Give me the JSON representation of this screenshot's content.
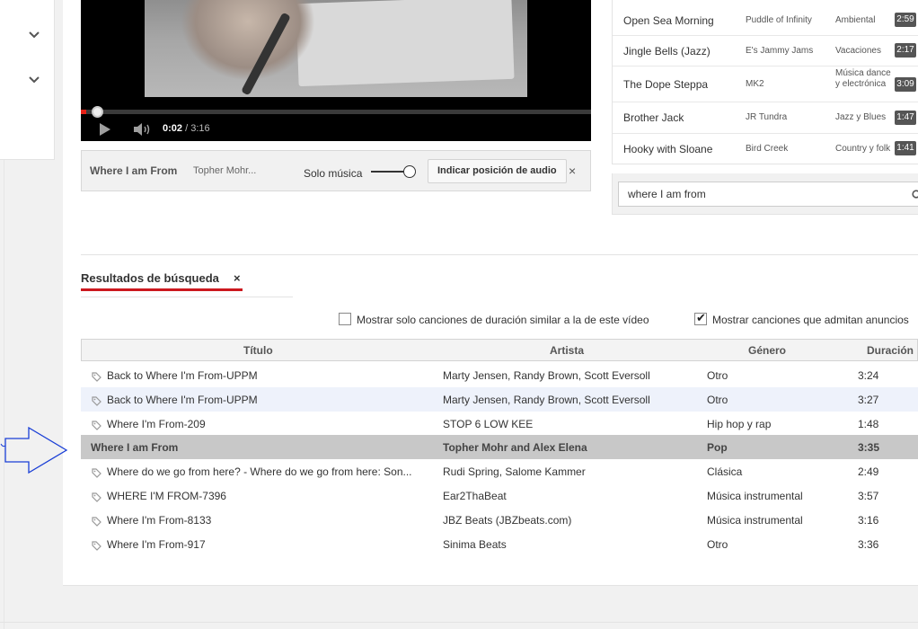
{
  "player": {
    "time_current": "0:02",
    "time_separator": " / ",
    "time_total": "3:16",
    "progress": 0.0106
  },
  "audio_bar": {
    "title": "Where I am From",
    "artist": "Topher Mohr...",
    "toggle_label": "Solo música",
    "toggle_on": true,
    "position_button": "Indicar posición de audio",
    "close": "×"
  },
  "song_list": [
    {
      "title": "Open Sea Morning",
      "artist": "Puddle of Infinity",
      "genre": "Ambiental",
      "duration": "2:59"
    },
    {
      "title": "Jingle Bells (Jazz)",
      "artist": "E's Jammy Jams",
      "genre": "Vacaciones",
      "duration": "2:17"
    },
    {
      "title": "The Dope Steppa",
      "artist": "MK2",
      "genre": "Música dance y electrónica",
      "duration": "3:09"
    },
    {
      "title": "Brother Jack",
      "artist": "JR Tundra",
      "genre": "Jazz y Blues",
      "duration": "1:47"
    },
    {
      "title": "Hooky with Sloane",
      "artist": "Bird Creek",
      "genre": "Country y folk",
      "duration": "1:41"
    }
  ],
  "search": {
    "value": "where I am from"
  },
  "results_tab": {
    "label": "Resultados de búsqueda",
    "close": "×"
  },
  "filters": {
    "similar_duration": {
      "label": "Mostrar solo canciones de duración similar a la de este vídeo",
      "checked": false
    },
    "allow_ads": {
      "label": "Mostrar canciones que admitan anuncios",
      "checked": true
    }
  },
  "table": {
    "headers": {
      "title": "Título",
      "artist": "Artista",
      "genre": "Género",
      "duration": "Duración"
    },
    "rows": [
      {
        "title": "Back to Where I'm From-UPPM",
        "artist": "Marty Jensen, Randy Brown, Scott Eversoll",
        "genre": "Otro",
        "duration": "3:24"
      },
      {
        "title": "Back to Where I'm From-UPPM",
        "artist": "Marty Jensen, Randy Brown, Scott Eversoll",
        "genre": "Otro",
        "duration": "3:27"
      },
      {
        "title": "Where I'm From-209",
        "artist": "STOP 6 LOW KEE",
        "genre": "Hip hop y rap",
        "duration": "1:48"
      },
      {
        "title": "Where I am From",
        "artist": "Topher Mohr and Alex Elena",
        "genre": "Pop",
        "duration": "3:35"
      },
      {
        "title": "Where do we go from here? - Where do we go from here: Son...",
        "artist": "Rudi Spring, Salome Kammer",
        "genre": "Clásica",
        "duration": "2:49"
      },
      {
        "title": "WHERE I'M FROM-7396",
        "artist": "Ear2ThaBeat",
        "genre": "Música instrumental",
        "duration": "3:57"
      },
      {
        "title": "Where I'm From-8133",
        "artist": "JBZ Beats (JBZbeats.com)",
        "genre": "Música instrumental",
        "duration": "3:16"
      },
      {
        "title": "Where I'm From-917",
        "artist": "Sinima Beats",
        "genre": "Otro",
        "duration": "3:36"
      }
    ],
    "selected_index": 3,
    "hover_index": 1
  },
  "colors": {
    "accent_red": "#cc181e",
    "progress_red": "#e62117",
    "selected_row": "#c8c8c8",
    "hover_row": "#eef2fb",
    "arrow_blue": "#1a3fd6"
  }
}
